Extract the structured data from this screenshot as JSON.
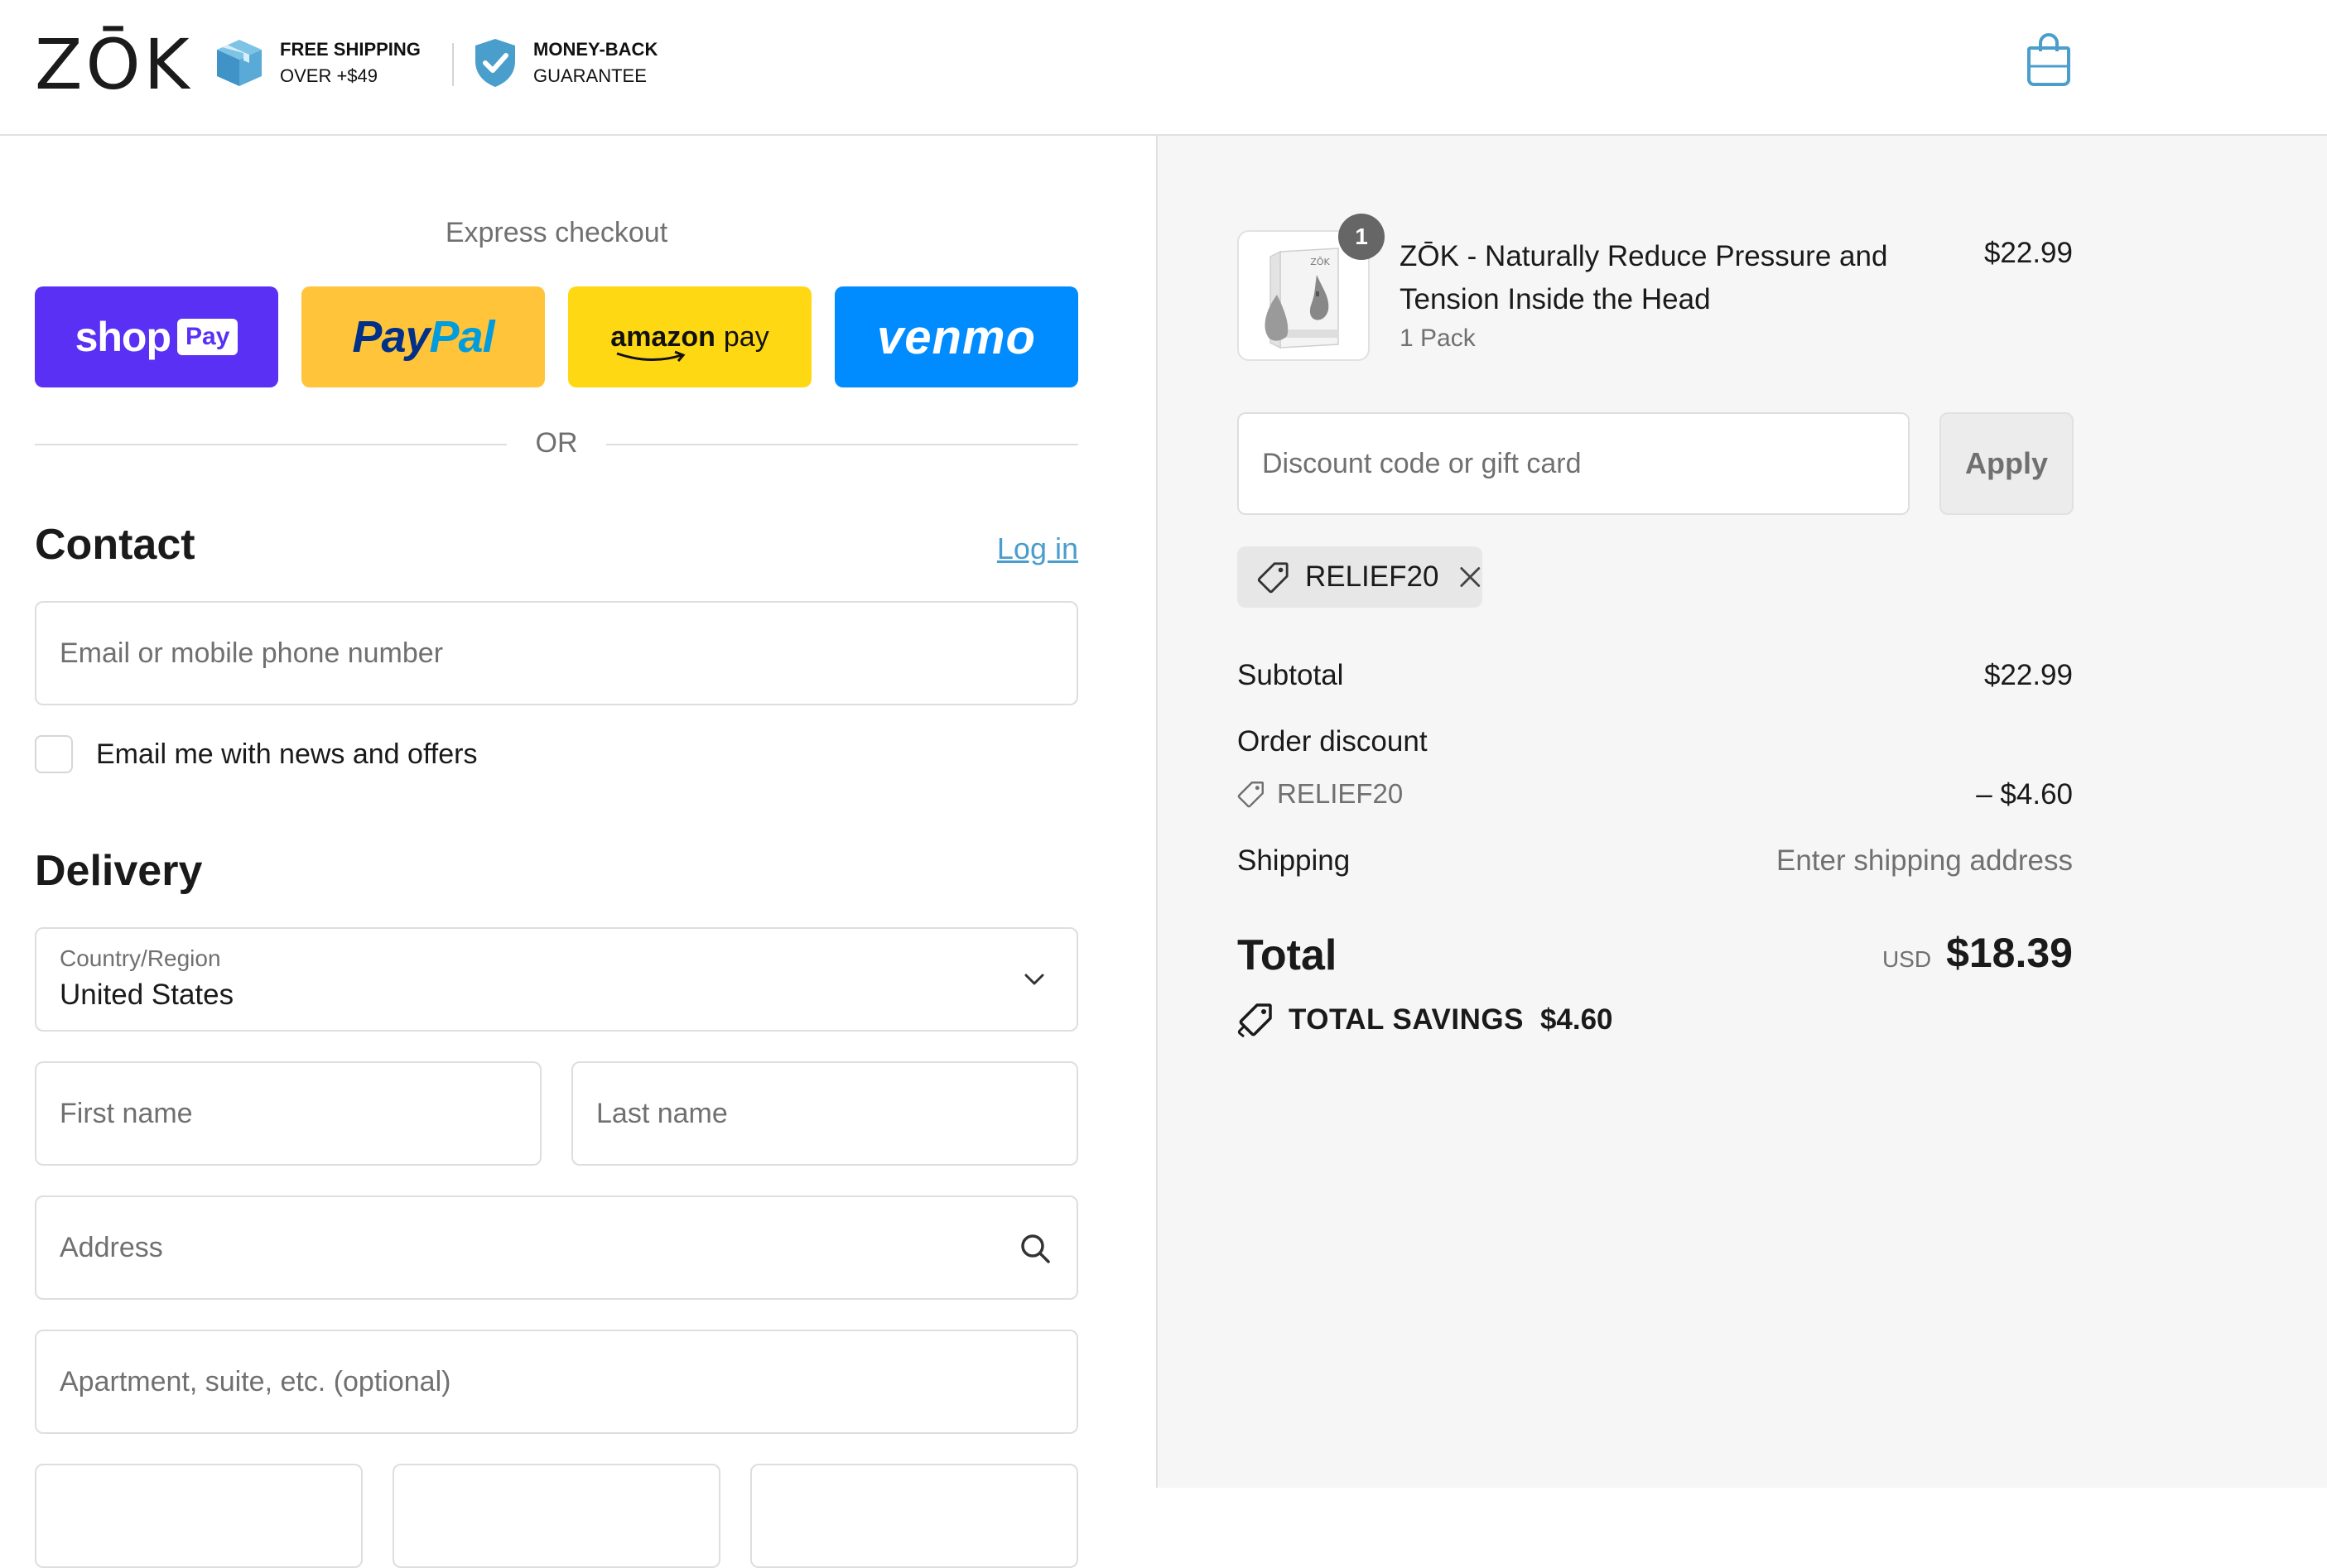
{
  "header": {
    "logo": "ZŌK",
    "shipping_badge": {
      "line1": "FREE SHIPPING",
      "line2": "OVER +$49"
    },
    "guarantee_badge": {
      "line1": "MONEY-BACK",
      "line2": "GUARANTEE"
    }
  },
  "express": {
    "title": "Express checkout",
    "shop_pay": {
      "word": "shop",
      "box": "Pay"
    },
    "paypal": {
      "part1": "Pay",
      "part2": "Pal"
    },
    "amazon": {
      "word1": "amazon",
      "word2": "pay"
    },
    "venmo": {
      "word": "venmo"
    },
    "or": "OR"
  },
  "contact": {
    "title": "Contact",
    "login": "Log in",
    "email_placeholder": "Email or mobile phone number",
    "newsletter_label": "Email me with news and offers"
  },
  "delivery": {
    "title": "Delivery",
    "country_label": "Country/Region",
    "country_value": "United States",
    "first_name_placeholder": "First name",
    "last_name_placeholder": "Last name",
    "address_placeholder": "Address",
    "apartment_placeholder": "Apartment, suite, etc. (optional)"
  },
  "order": {
    "product": {
      "quantity": "1",
      "name": "ZŌK - Naturally Reduce Pressure and Tension Inside the Head",
      "variant": "1 Pack",
      "price": "$22.99",
      "box_logo": "ZŌK"
    },
    "discount_placeholder": "Discount code or gift card",
    "apply_label": "Apply",
    "applied_code": "RELIEF20",
    "subtotal_label": "Subtotal",
    "subtotal_value": "$22.99",
    "order_discount_label": "Order discount",
    "discount_code": "RELIEF20",
    "discount_value": "– $4.60",
    "shipping_label": "Shipping",
    "shipping_value": "Enter shipping address",
    "total_label": "Total",
    "currency": "USD",
    "total_value": "$18.39",
    "savings_label": "TOTAL SAVINGS",
    "savings_value": "$4.60"
  },
  "colors": {
    "accent": "#4a9ecb",
    "shop_pay": "#5a31f4",
    "paypal": "#ffc439",
    "amazon": "#ffd814",
    "venmo": "#008cff",
    "panel_bg": "#f6f6f6"
  }
}
